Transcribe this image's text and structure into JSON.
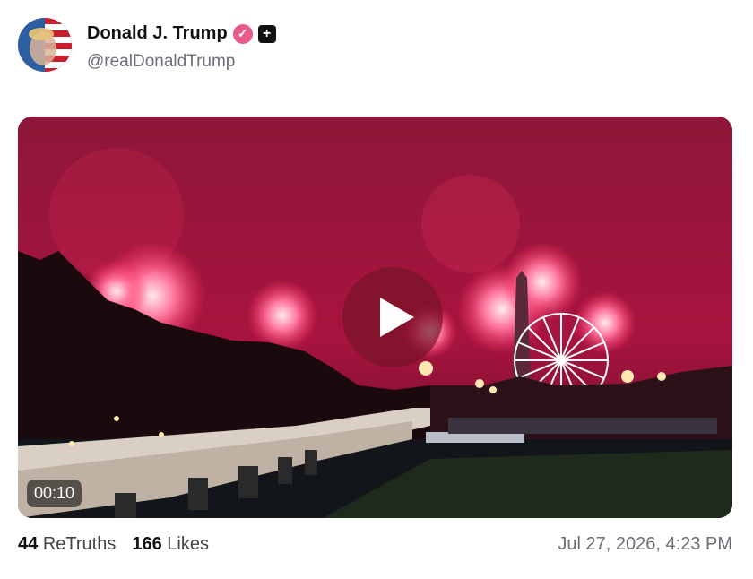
{
  "post": {
    "author": {
      "display_name": "Donald J. Trump",
      "handle": "@realDonaldTrump",
      "verified_icon": "verified-check-icon",
      "badge_icon": "plus-icon",
      "verified_color": "#e85a8c"
    },
    "media": {
      "type": "video",
      "duration": "00:10",
      "play_icon": "play-icon"
    },
    "stats": {
      "retruths_count": "44",
      "retruths_label": "ReTruths",
      "likes_count": "166",
      "likes_label": "Likes"
    },
    "timestamp": "Jul 27, 2026, 4:23 PM"
  }
}
